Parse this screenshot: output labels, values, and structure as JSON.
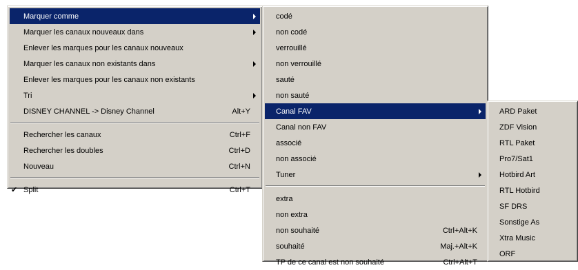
{
  "menu_main": {
    "items": [
      {
        "label": "Marquer comme",
        "shortcut": "",
        "submenu": true,
        "selected": true
      },
      {
        "label": "Marquer les canaux nouveaux dans",
        "shortcut": "",
        "submenu": true
      },
      {
        "label": "Enlever les marques pour les canaux nouveaux",
        "shortcut": ""
      },
      {
        "label": "Marquer les canaux non existants dans",
        "shortcut": "",
        "submenu": true
      },
      {
        "label": "Enlever les marques pour les canaux non existants",
        "shortcut": ""
      },
      {
        "label": "Tri",
        "shortcut": "",
        "submenu": true
      },
      {
        "label": "DISNEY CHANNEL -> Disney Channel",
        "shortcut": "Alt+Y"
      },
      {
        "label": "Rechercher les canaux",
        "shortcut": "Ctrl+F"
      },
      {
        "label": "Rechercher les doubles",
        "shortcut": "Ctrl+D"
      },
      {
        "label": "Nouveau",
        "shortcut": "Ctrl+N"
      },
      {
        "label": "Split",
        "shortcut": "Ctrl+T",
        "checked": true
      }
    ],
    "check_mark": "✔"
  },
  "menu_mark_as": {
    "items": [
      {
        "label": "codé",
        "shortcut": ""
      },
      {
        "label": "non codé",
        "shortcut": ""
      },
      {
        "label": "verrouillé",
        "shortcut": ""
      },
      {
        "label": "non verrouillé",
        "shortcut": ""
      },
      {
        "label": "sauté",
        "shortcut": ""
      },
      {
        "label": "non sauté",
        "shortcut": ""
      },
      {
        "label": "Canal FAV",
        "shortcut": "",
        "submenu": true,
        "selected": true
      },
      {
        "label": "Canal non FAV",
        "shortcut": ""
      },
      {
        "label": "associé",
        "shortcut": ""
      },
      {
        "label": "non associé",
        "shortcut": ""
      },
      {
        "label": "Tuner",
        "shortcut": "",
        "submenu": true
      },
      {
        "label": "extra",
        "shortcut": ""
      },
      {
        "label": "non extra",
        "shortcut": ""
      },
      {
        "label": "non souhaité",
        "shortcut": "Ctrl+Alt+K"
      },
      {
        "label": "souhaité",
        "shortcut": "Maj.+Alt+K"
      },
      {
        "label": "TP de ce canal est non souhaité",
        "shortcut": "Ctrl+Alt+T"
      }
    ]
  },
  "menu_fav": {
    "items": [
      {
        "label": "ARD Paket"
      },
      {
        "label": "ZDF Vision"
      },
      {
        "label": "RTL Paket"
      },
      {
        "label": "Pro7/Sat1"
      },
      {
        "label": "Hotbird Art"
      },
      {
        "label": "RTL Hotbird"
      },
      {
        "label": "SF DRS"
      },
      {
        "label": "Sonstige As"
      },
      {
        "label": "Xtra Music"
      },
      {
        "label": "ORF"
      }
    ]
  },
  "colors": {
    "menu_bg": "#d4d0c8",
    "highlight_bg": "#0a246a",
    "highlight_text": "#ffffff"
  }
}
